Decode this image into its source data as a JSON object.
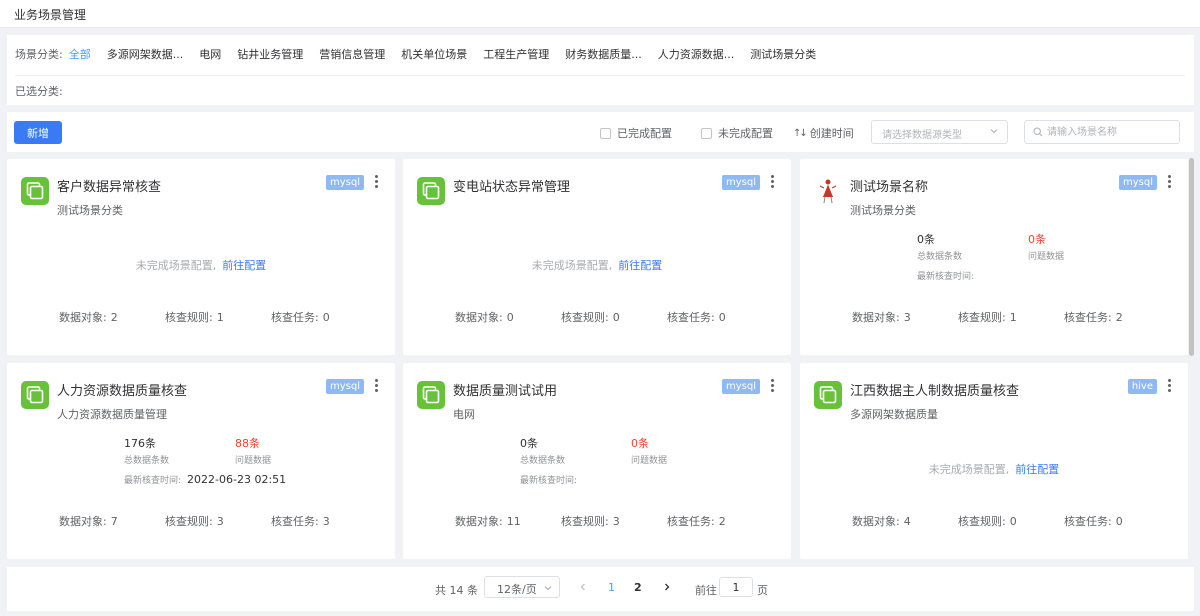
{
  "page": {
    "title": "业务场景管理"
  },
  "filter": {
    "label": "场景分类:",
    "categories": [
      {
        "label": "全部",
        "active": true
      },
      {
        "label": "多源网架数据...",
        "active": false
      },
      {
        "label": "电网",
        "active": false
      },
      {
        "label": "钻井业务管理",
        "active": false
      },
      {
        "label": "营销信息管理",
        "active": false
      },
      {
        "label": "机关单位场景",
        "active": false
      },
      {
        "label": "工程生产管理",
        "active": false
      },
      {
        "label": "财务数据质量...",
        "active": false
      },
      {
        "label": "人力资源数据...",
        "active": false
      },
      {
        "label": "测试场景分类",
        "active": false
      }
    ],
    "selected_label": "已选分类:"
  },
  "toolbar": {
    "add_label": "新增",
    "completed_label": "已完成配置",
    "incomplete_label": "未完成配置",
    "sort_label": "创建时间",
    "sort_icon": "↑↓",
    "datasource_placeholder": "请选择数据源类型",
    "search_placeholder": "请输入场景名称"
  },
  "labels": {
    "total_caption": "总数据条数",
    "issue_caption": "问题数据",
    "last_check": "最新核查时间:",
    "pending": "未完成场景配置,",
    "goto_config": "前往配置",
    "objects": "数据对象:",
    "rules": "核查规则:",
    "tasks": "核查任务:"
  },
  "cards": [
    {
      "title": "客户数据异常核查",
      "subtitle": "测试场景分类",
      "tag": "mysql",
      "icon": "stack-icon",
      "configured": false,
      "objects": "2",
      "rules": "1",
      "tasks": "0"
    },
    {
      "title": "变电站状态异常管理",
      "subtitle": "",
      "tag": "mysql",
      "icon": "stack-icon",
      "configured": false,
      "objects": "0",
      "rules": "0",
      "tasks": "0"
    },
    {
      "title": "测试场景名称",
      "subtitle": "测试场景分类",
      "tag": "mysql",
      "icon": "figure-icon",
      "configured": true,
      "total": "0条",
      "issues": "0条",
      "last_check_time": "",
      "objects": "3",
      "rules": "1",
      "tasks": "2"
    },
    {
      "title": "人力资源数据质量核查",
      "subtitle": "人力资源数据质量管理",
      "tag": "mysql",
      "icon": "stack-icon",
      "configured": true,
      "total": "176条",
      "issues": "88条",
      "last_check_time": "2022-06-23 02:51",
      "objects": "7",
      "rules": "3",
      "tasks": "3"
    },
    {
      "title": "数据质量测试试用",
      "subtitle": "电网",
      "tag": "mysql",
      "icon": "stack-icon",
      "configured": true,
      "total": "0条",
      "issues": "0条",
      "last_check_time": "",
      "objects": "11",
      "rules": "3",
      "tasks": "2"
    },
    {
      "title": "江西数据主人制数据质量核查",
      "subtitle": "多源网架数据质量",
      "tag": "hive",
      "icon": "stack-icon",
      "configured": false,
      "objects": "4",
      "rules": "0",
      "tasks": "0"
    }
  ],
  "pagination": {
    "total_text": "共 14 条",
    "page_size": "12条/页",
    "pages": [
      "1",
      "2"
    ],
    "current_page": "1",
    "goto_label": "前往",
    "goto_value": "1",
    "page_word": "页"
  },
  "colors": {
    "accent": "#3a7bf5",
    "icon_green": "#67c23a",
    "issue_red": "#f04134",
    "tag_blue": "#8fb9f5"
  }
}
